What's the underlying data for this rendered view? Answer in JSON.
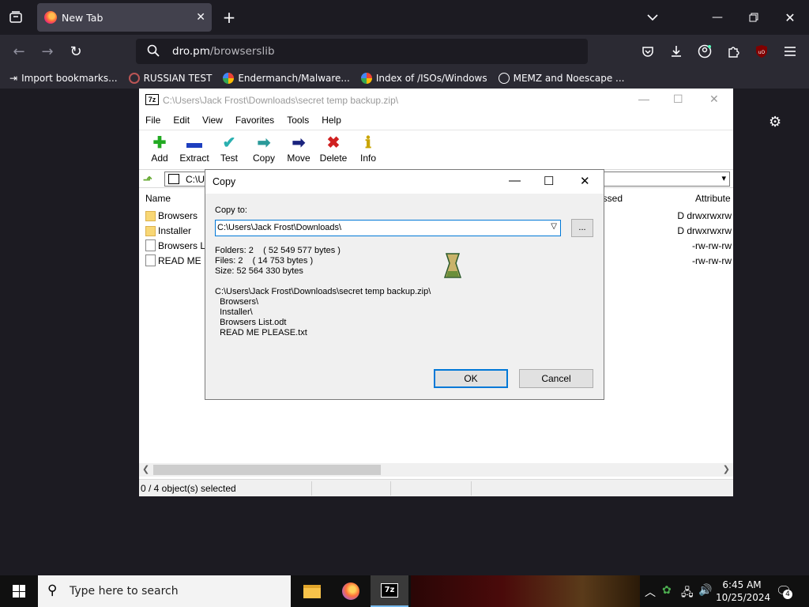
{
  "browser": {
    "tab_title": "New Tab",
    "url_domain": "dro.pm",
    "url_path": "/browserslib",
    "bookmarks": [
      {
        "label": "Import bookmarks...",
        "icon": "import-icon"
      },
      {
        "label": "RUSSIAN TEST",
        "icon": "site-icon"
      },
      {
        "label": "Endermanch/Malware...",
        "icon": "google-icon"
      },
      {
        "label": "Index of /ISOs/Windows",
        "icon": "google-icon"
      },
      {
        "label": "MEMZ and Noescape ...",
        "icon": "globe-icon"
      }
    ]
  },
  "zip": {
    "title": "C:\\Users\\Jack Frost\\Downloads\\secret temp backup.zip\\",
    "menu": [
      "File",
      "Edit",
      "View",
      "Favorites",
      "Tools",
      "Help"
    ],
    "toolbar": [
      {
        "label": "Add",
        "icon": "plus-icon",
        "color": "#22aa22",
        "glyph": "✚"
      },
      {
        "label": "Extract",
        "icon": "minus-icon",
        "color": "#1e3fbf",
        "glyph": "▬"
      },
      {
        "label": "Test",
        "icon": "checkmark-icon",
        "color": "#2ab0b0",
        "glyph": "✔"
      },
      {
        "label": "Copy",
        "icon": "copy-arrow-icon",
        "color": "#2a9a9a",
        "glyph": "➡"
      },
      {
        "label": "Move",
        "icon": "move-arrow-icon",
        "color": "#1a237e",
        "glyph": "➡"
      },
      {
        "label": "Delete",
        "icon": "delete-x-icon",
        "color": "#d02020",
        "glyph": "✖"
      },
      {
        "label": "Info",
        "icon": "info-icon",
        "color": "#c9a400",
        "glyph": "ℹ"
      }
    ],
    "address": "C:\\Us",
    "columns": {
      "name": "Name",
      "compressed": "essed",
      "attributes": "Attribute"
    },
    "files": [
      {
        "name": "Browsers",
        "type": "folder",
        "attr": "D drwxrwxrw"
      },
      {
        "name": "Installer",
        "type": "folder",
        "attr": "D drwxrwxrw"
      },
      {
        "name": "Browsers Li",
        "type": "file",
        "attr": "-rw-rw-rw"
      },
      {
        "name": "READ ME P",
        "type": "file",
        "attr": "-rw-rw-rw"
      }
    ],
    "status": "0 / 4 object(s) selected"
  },
  "copy_dialog": {
    "title": "Copy",
    "copy_to_label": "Copy to:",
    "copy_to_value": "C:\\Users\\Jack Frost\\Downloads\\",
    "browse_label": "...",
    "stats": [
      "Folders: 2    ( 52 549 577 bytes )",
      "Files: 2    ( 14 753 bytes )",
      "Size: 52 564 330 bytes"
    ],
    "tree": [
      "C:\\Users\\Jack Frost\\Downloads\\secret temp backup.zip\\",
      "  Browsers\\",
      "  Installer\\",
      "  Browsers List.odt",
      "  READ ME PLEASE.txt"
    ],
    "ok_label": "OK",
    "cancel_label": "Cancel"
  },
  "taskbar": {
    "search_placeholder": "Type here to search",
    "time": "6:45 AM",
    "date": "10/25/2024",
    "notification_count": "4"
  }
}
